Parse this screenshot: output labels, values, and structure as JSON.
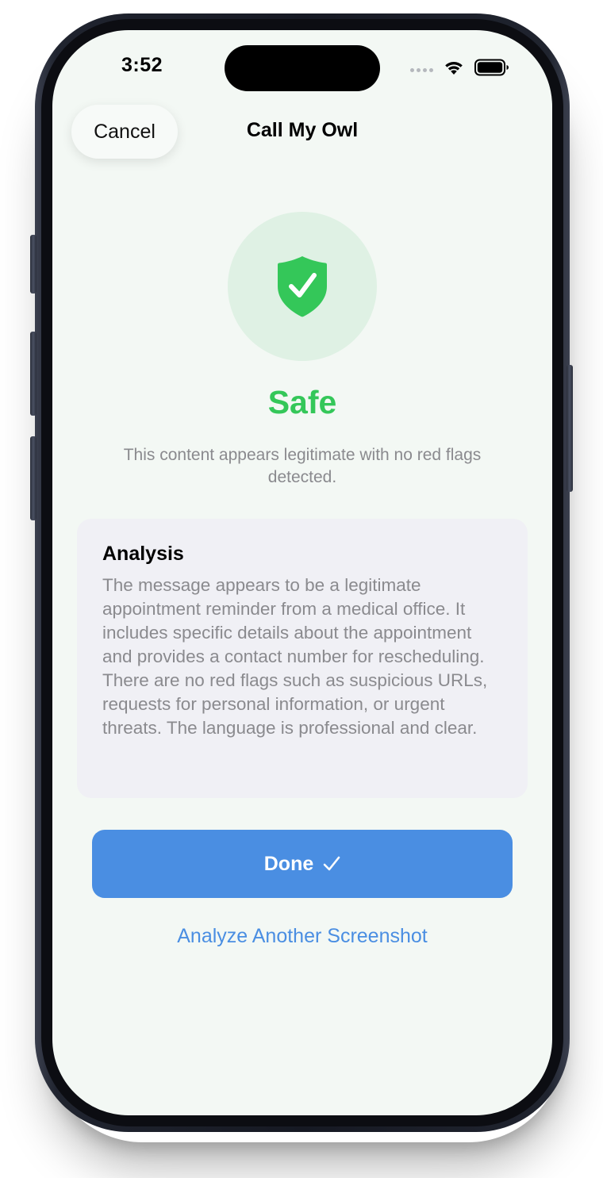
{
  "status_bar": {
    "time": "3:52"
  },
  "nav": {
    "cancel_label": "Cancel",
    "title": "Call My Owl"
  },
  "result": {
    "icon": "shield-check-icon",
    "label": "Safe",
    "description": "This content appears legitimate with no red flags detected."
  },
  "analysis": {
    "title": "Analysis",
    "text": "The message appears to be a legitimate appointment reminder from a medical office. It includes specific details about the appointment and provides a contact number for rescheduling. There are no red flags such as suspicious URLs, requests for personal information, or urgent threats. The language is professional and clear."
  },
  "actions": {
    "done_label": "Done",
    "done_icon": "checkmark-icon",
    "another_label": "Analyze Another Screenshot"
  },
  "colors": {
    "safe_green": "#34c759",
    "safe_circle": "#dff1e4",
    "accent_blue": "#4a8ee2",
    "screen_bg": "#f3f8f4",
    "card_bg": "#f0f0f5",
    "secondary_text": "#8a8a8e"
  }
}
